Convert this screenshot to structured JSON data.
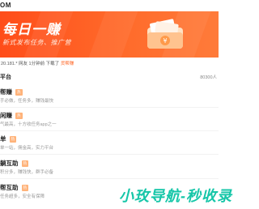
{
  "topbar": {
    "brand": "OM"
  },
  "banner": {
    "title": "每日一赚",
    "subtitle": "新式发布任务、推广营"
  },
  "notice": {
    "prefix": "20.181.*",
    "middle": "网友 1分钟前 下载了",
    "suffix": "货帮赚"
  },
  "section": {
    "label": "平台",
    "count": "80300人"
  },
  "items": [
    {
      "name": "帮赚",
      "tag": "热",
      "desc": "手必做，任务多，赚钱最快"
    },
    {
      "name": "闲赚",
      "tag": "热",
      "desc": "气最高，十方收任务app之一"
    },
    {
      "name": "单",
      "tag": "热",
      "desc": "单一站，佣金高，实力平台"
    },
    {
      "name": "躺互助",
      "tag": "热",
      "desc": "积分多，赚钱快，群手必备"
    },
    {
      "name": "帮互助",
      "tag": "热",
      "desc": "任务超多，安全有保障"
    }
  ],
  "watermark": {
    "text": "小玫导航-秒收录"
  },
  "colors": {
    "accent": "#ff6a2a",
    "watermark": "#16c6a8",
    "tag": "#ffb37a"
  }
}
